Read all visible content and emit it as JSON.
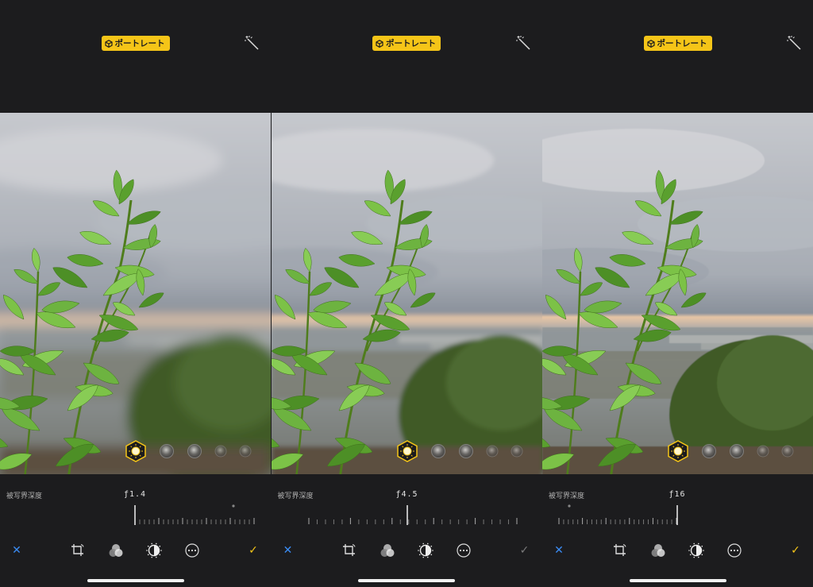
{
  "panels": [
    {
      "mode_label": "ポートレート",
      "dof_label": "被写界深度",
      "f_value": "ƒ1.4",
      "done_active": true,
      "blur": 7,
      "indicator_fraction": 0.0
    },
    {
      "mode_label": "ポートレート",
      "dof_label": "被写界深度",
      "f_value": "ƒ4.5",
      "done_active": false,
      "blur": 3,
      "indicator_fraction": 0.5
    },
    {
      "mode_label": "ポートレート",
      "dof_label": "被写界深度",
      "f_value": "ƒ16",
      "done_active": true,
      "blur": 0.6,
      "indicator_fraction": 1.0
    }
  ],
  "icons": {
    "mode": "cube-icon",
    "wand": "magic-wand-icon",
    "cancel": "close-icon",
    "crop": "crop-rotate-icon",
    "filters": "filters-icon",
    "adjust": "adjust-dial-icon",
    "more": "more-icon",
    "done": "checkmark-icon"
  },
  "colors": {
    "accent": "#f5c518",
    "cancel": "#3b8cf5",
    "done_active": "#f5c518",
    "done_inactive": "#7a7a7a",
    "background": "#1c1c1e"
  }
}
